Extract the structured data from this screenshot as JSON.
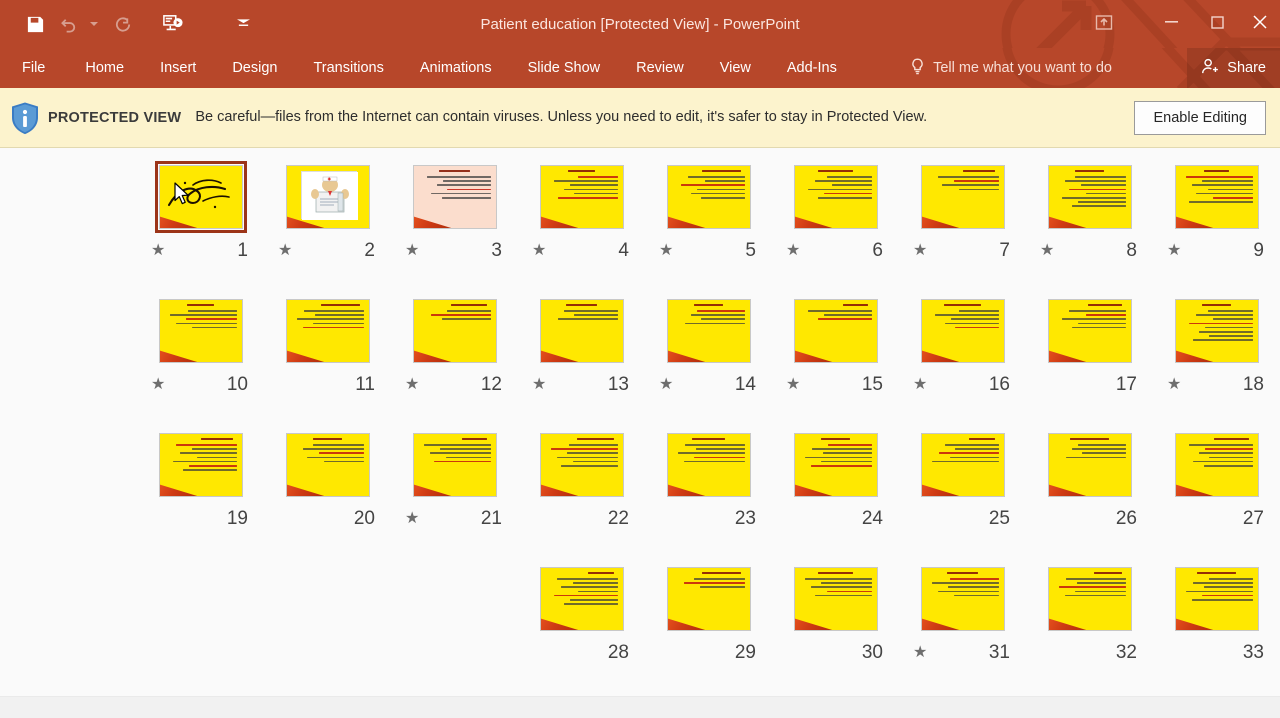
{
  "window": {
    "title": "Patient education [Protected View] - PowerPoint",
    "quick_access": [
      {
        "name": "save-icon",
        "label": "Save",
        "enabled": true
      },
      {
        "name": "undo-icon",
        "label": "Undo",
        "enabled": false
      },
      {
        "name": "undo-dropdown-icon",
        "label": "Undo options",
        "enabled": false
      },
      {
        "name": "redo-icon",
        "label": "Redo",
        "enabled": false
      },
      {
        "name": "start-presentation-icon",
        "label": "Start From Beginning",
        "enabled": true
      },
      {
        "name": "customize-quick-access-icon",
        "label": "Customize Quick Access Toolbar",
        "enabled": true
      }
    ],
    "controls": {
      "ribbon_display": "Ribbon Display Options",
      "minimize": "Minimize",
      "restore": "Restore Down",
      "close": "Close"
    }
  },
  "ribbon": {
    "tabs": [
      {
        "label": "File"
      },
      {
        "label": "Home"
      },
      {
        "label": "Insert"
      },
      {
        "label": "Design"
      },
      {
        "label": "Transitions"
      },
      {
        "label": "Animations"
      },
      {
        "label": "Slide Show"
      },
      {
        "label": "Review"
      },
      {
        "label": "View"
      },
      {
        "label": "Add-Ins"
      }
    ],
    "tell_me": "Tell me what you want to do",
    "share": "Share"
  },
  "protected_view": {
    "label": "PROTECTED VIEW",
    "message": "Be careful—files from the Internet can contain viruses. Unless you need to edit, it's safer to stay in Protected View.",
    "enable_button": "Enable Editing"
  },
  "colors": {
    "accent": "#b7472a",
    "protected_bar": "#fcf3cd",
    "selection_border": "#9c3418",
    "slide_yellow": "#ffe800",
    "slide_peach": "#fbddcd"
  },
  "slides": {
    "rows": [
      [
        {
          "number": "9",
          "star": true,
          "selected": false,
          "kind": "text",
          "bg": "yellow",
          "lines": 7
        },
        {
          "number": "8",
          "star": true,
          "selected": false,
          "kind": "text",
          "bg": "yellow",
          "lines": 8
        },
        {
          "number": "7",
          "star": true,
          "selected": false,
          "kind": "text",
          "bg": "yellow",
          "lines": 4
        },
        {
          "number": "6",
          "star": true,
          "selected": false,
          "kind": "text",
          "bg": "yellow",
          "lines": 6
        },
        {
          "number": "5",
          "star": true,
          "selected": false,
          "kind": "text",
          "bg": "yellow",
          "lines": 6
        },
        {
          "number": "4",
          "star": true,
          "selected": false,
          "kind": "text",
          "bg": "yellow",
          "lines": 6
        },
        {
          "number": "3",
          "star": true,
          "selected": false,
          "kind": "text",
          "bg": "peach",
          "lines": 6
        },
        {
          "number": "2",
          "star": true,
          "selected": false,
          "kind": "picture",
          "bg": "yellow",
          "lines": 0
        },
        {
          "number": "1",
          "star": true,
          "selected": true,
          "kind": "calligraphy",
          "bg": "yellow",
          "lines": 0
        }
      ],
      [
        {
          "number": "18",
          "star": true,
          "selected": false,
          "kind": "text",
          "bg": "yellow",
          "lines": 8
        },
        {
          "number": "17",
          "star": false,
          "selected": false,
          "kind": "text",
          "bg": "yellow",
          "lines": 5
        },
        {
          "number": "16",
          "star": true,
          "selected": false,
          "kind": "text",
          "bg": "yellow",
          "lines": 5
        },
        {
          "number": "15",
          "star": true,
          "selected": false,
          "kind": "text",
          "bg": "yellow",
          "lines": 3
        },
        {
          "number": "14",
          "star": true,
          "selected": false,
          "kind": "text",
          "bg": "yellow",
          "lines": 4
        },
        {
          "number": "13",
          "star": true,
          "selected": false,
          "kind": "text",
          "bg": "yellow",
          "lines": 3
        },
        {
          "number": "12",
          "star": true,
          "selected": false,
          "kind": "text",
          "bg": "yellow",
          "lines": 3
        },
        {
          "number": "11",
          "star": false,
          "selected": false,
          "kind": "text",
          "bg": "yellow",
          "lines": 5
        },
        {
          "number": "10",
          "star": true,
          "selected": false,
          "kind": "text",
          "bg": "yellow",
          "lines": 5
        }
      ],
      [
        {
          "number": "27",
          "star": false,
          "selected": false,
          "kind": "text",
          "bg": "yellow",
          "lines": 6
        },
        {
          "number": "26",
          "star": false,
          "selected": false,
          "kind": "text",
          "bg": "yellow",
          "lines": 4
        },
        {
          "number": "25",
          "star": false,
          "selected": false,
          "kind": "text",
          "bg": "yellow",
          "lines": 5
        },
        {
          "number": "24",
          "star": false,
          "selected": false,
          "kind": "text",
          "bg": "yellow",
          "lines": 6
        },
        {
          "number": "23",
          "star": false,
          "selected": false,
          "kind": "text",
          "bg": "yellow",
          "lines": 5
        },
        {
          "number": "22",
          "star": false,
          "selected": false,
          "kind": "text",
          "bg": "yellow",
          "lines": 6
        },
        {
          "number": "21",
          "star": true,
          "selected": false,
          "kind": "text",
          "bg": "yellow",
          "lines": 5
        },
        {
          "number": "20",
          "star": false,
          "selected": false,
          "kind": "text",
          "bg": "yellow",
          "lines": 5
        },
        {
          "number": "19",
          "star": false,
          "selected": false,
          "kind": "text",
          "bg": "yellow",
          "lines": 7
        }
      ],
      [
        {
          "number": "33",
          "star": false,
          "selected": false,
          "kind": "text",
          "bg": "yellow",
          "lines": 6
        },
        {
          "number": "32",
          "star": false,
          "selected": false,
          "kind": "text",
          "bg": "yellow",
          "lines": 5
        },
        {
          "number": "31",
          "star": true,
          "selected": false,
          "kind": "text",
          "bg": "yellow",
          "lines": 5
        },
        {
          "number": "30",
          "star": false,
          "selected": false,
          "kind": "text",
          "bg": "yellow",
          "lines": 5
        },
        {
          "number": "29",
          "star": false,
          "selected": false,
          "kind": "text",
          "bg": "yellow",
          "lines": 3
        },
        {
          "number": "28",
          "star": false,
          "selected": false,
          "kind": "text",
          "bg": "yellow",
          "lines": 7
        }
      ]
    ],
    "star_glyph": "★"
  }
}
